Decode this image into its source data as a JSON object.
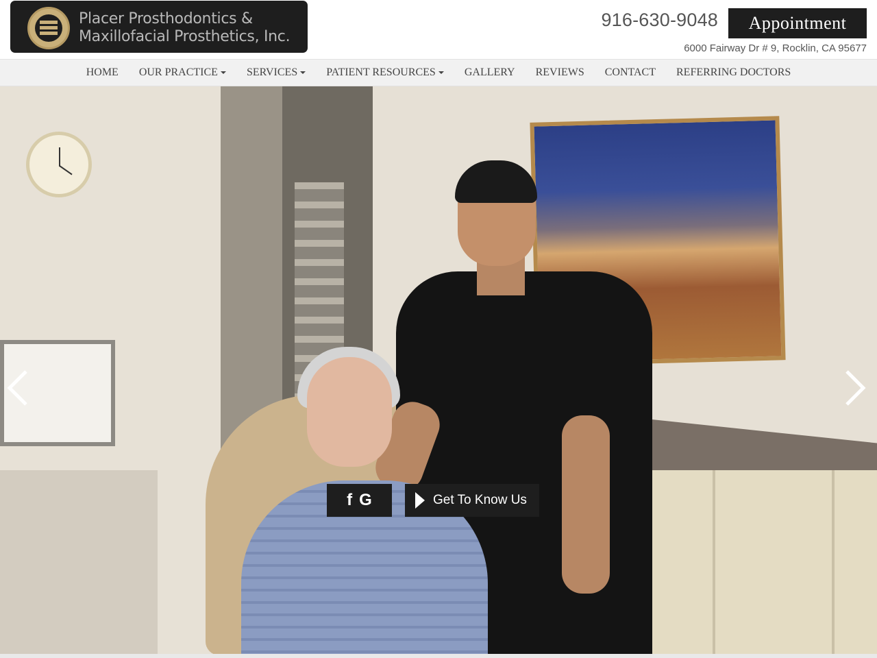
{
  "header": {
    "logo_line1": "Placer Prosthodontics &",
    "logo_line2": "Maxillofacial Prosthetics, Inc.",
    "phone": "916-630-9048",
    "appointment_label": "Appointment",
    "address": "6000 Fairway Dr # 9, Rocklin, CA 95677"
  },
  "nav": {
    "items": [
      {
        "label": "HOME",
        "dropdown": false
      },
      {
        "label": "OUR PRACTICE",
        "dropdown": true
      },
      {
        "label": "SERVICES",
        "dropdown": true
      },
      {
        "label": "PATIENT RESOURCES",
        "dropdown": true
      },
      {
        "label": "GALLERY",
        "dropdown": false
      },
      {
        "label": "REVIEWS",
        "dropdown": false
      },
      {
        "label": "CONTACT",
        "dropdown": false
      },
      {
        "label": "REFERRING DOCTORS",
        "dropdown": false
      }
    ]
  },
  "hero": {
    "social": {
      "facebook": "f",
      "google": "G"
    },
    "cta_label": "Get To Know Us",
    "icons": [
      "chevron-left-icon",
      "chevron-right-icon",
      "facebook-icon",
      "google-icon",
      "play-icon"
    ]
  },
  "colors": {
    "dark": "#1e1e1e",
    "nav_bg": "#f1f1f1",
    "logo_gold": "#c9b07a",
    "text_gray": "#555555"
  }
}
